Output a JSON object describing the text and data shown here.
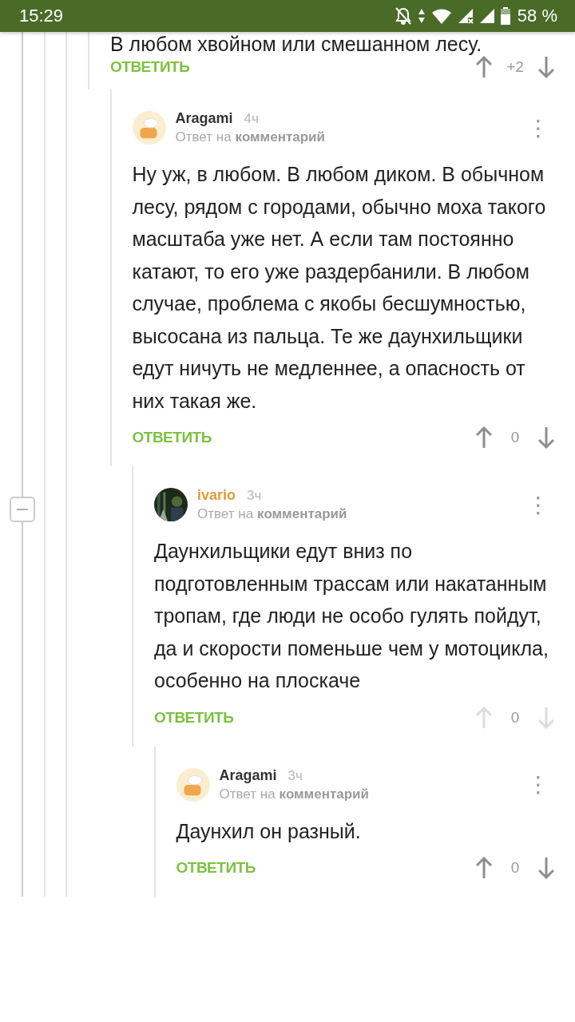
{
  "status_bar": {
    "time": "15:29",
    "battery": "58 %"
  },
  "comments": [
    {
      "text": "В любом хвойном или смешанном лесу.",
      "reply": "ОТВЕТИТЬ",
      "score": "+2",
      "vote_disabled": false,
      "children": [
        {
          "author": "Aragami",
          "color": "#333333",
          "avatar": {
            "kind": "cartoon"
          },
          "time": "4ч",
          "reply_to": "Ответ на",
          "reply_to_link": "комментарий",
          "menu": "⋮",
          "text": "Ну уж, в любом. В любом диком. В обычном лесу, рядом с городами, обычно моха такого масштаба уже нет. А если там постоянно катают, то его уже раздербанили. В любом случае, проблема с якобы бесшумностью, высосана из пальца. Те же даунхильщики едут ничуть не медленнее, а опасность от них такая же.",
          "reply": "ОТВЕТИТЬ",
          "score": "0",
          "vote_disabled": false,
          "collapse": "−",
          "children": [
            {
              "author": "ivario",
              "color": "#e39b3b",
              "time": "3ч",
              "reply_to": "Ответ на",
              "reply_to_link": "комментарий",
              "menu": "⋮",
              "text": "Даунхильщики едут вниз по подготовленным трассам или накатанным тропам, где люди не особо гулять пойдут, да и скорости поменьше чем у мотоцикла, особенно на плоскаче",
              "reply": "ОТВЕТИТЬ",
              "score": "0",
              "vote_disabled": true,
              "children": [
                {
                  "author": "Aragami",
                  "color": "#333333",
                  "avatar": {
                    "kind": "cartoon"
                  },
                  "time": "3ч",
                  "reply_to": "Ответ на",
                  "reply_to_link": "комментарий",
                  "menu": "⋮",
                  "text": "Даунхил он разный.",
                  "reply": "ОТВЕТИТЬ",
                  "score": "0",
                  "vote_disabled": false
                }
              ]
            }
          ]
        }
      ]
    }
  ]
}
